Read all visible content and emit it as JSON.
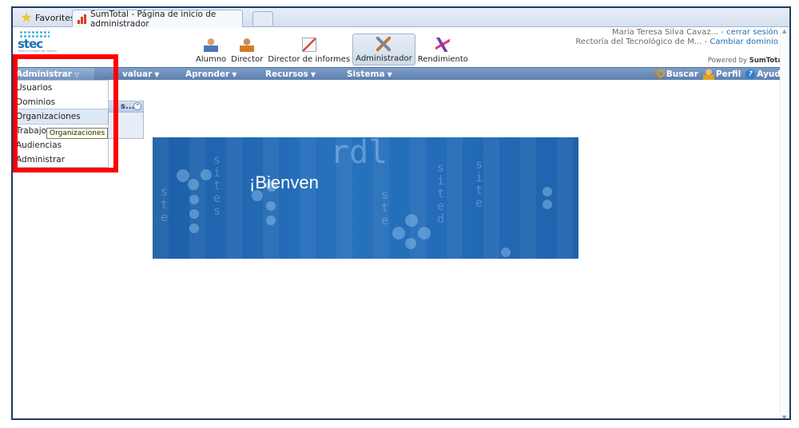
{
  "browser": {
    "favorites_label": "Favorites",
    "tab_title": "SumTotal - Página de inicio de administrador"
  },
  "header": {
    "logo_text": "stec",
    "logo_tagline": "Sistema Integral del Talento",
    "roles": [
      {
        "label": "Alumno",
        "icon": "student-icon"
      },
      {
        "label": "Director",
        "icon": "manager-icon"
      },
      {
        "label": "Director de informes",
        "icon": "report-icon"
      },
      {
        "label": "Administrador",
        "icon": "tools-icon",
        "active": true
      },
      {
        "label": "Rendimiento",
        "icon": "performance-icon"
      }
    ],
    "user_name": "María Teresa Silva Cavaz...",
    "logout_sep": " - ",
    "logout_label": "cerrar sesión",
    "domain_name": "Rectoría del Tecnológico de M...",
    "change_domain_label": "Cambiar dominio",
    "powered_prefix": "Powered by ",
    "powered_brand": "SumTotal"
  },
  "nav": {
    "administrar": "Administrar",
    "evaluar": "valuar",
    "aprender": "Aprender",
    "recursos": "Recursos",
    "sistema": "Sistema",
    "buscar": "Buscar",
    "perfil": "Perfil",
    "ayuda": "Ayuda"
  },
  "left_panel": {
    "title_fragment": "s..."
  },
  "dropdown": {
    "items": [
      "Usuarios",
      "Dominios",
      "Organizaciones",
      "Trabajos",
      "Audiencias",
      "Administrar"
    ],
    "highlighted": "Organizaciones",
    "tooltip": "Organizaciones"
  },
  "banner": {
    "title": "¡Bienven",
    "big_glyph": "rdl"
  },
  "colors": {
    "nav_bar": "#6a8dbb",
    "banner": "#2772be",
    "highlight_box": "#ff0000",
    "link": "#1f6fb5"
  }
}
